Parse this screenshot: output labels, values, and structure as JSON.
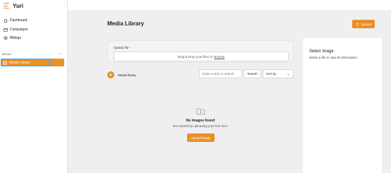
{
  "brand": {
    "name": "Yuri",
    "menu_icon": "hamburger-icon"
  },
  "sidebar": {
    "items": [
      {
        "label": "Dashboard",
        "icon": "home-icon"
      },
      {
        "label": "Campaigns",
        "icon": "calendar-icon"
      },
      {
        "label": "Billings",
        "icon": "layers-icon"
      }
    ],
    "section_label": "MEDIA",
    "media_item": {
      "label": "Media Library",
      "icon": "media-icon"
    }
  },
  "main": {
    "title": "Media Library",
    "upload_button": "Upload",
    "upload_file_label": "Upload file",
    "required_mark": "*",
    "dropzone_text": "Drag & Drop your files or",
    "dropzone_browse": "Browse",
    "library_label": "Media library",
    "search": {
      "placeholder": "Enter a term to search",
      "button": "Search"
    },
    "sort": {
      "selected": "Sort by"
    },
    "empty": {
      "title": "No images found",
      "subtitle": "Get started by uploading your first item.",
      "button": "Upload image"
    }
  },
  "right_panel": {
    "title": "Select image",
    "subtitle": "Select a file to view its information."
  },
  "colors": {
    "accent": "#e8902a",
    "focus": "#4aa3df",
    "background": "#efeff2"
  }
}
